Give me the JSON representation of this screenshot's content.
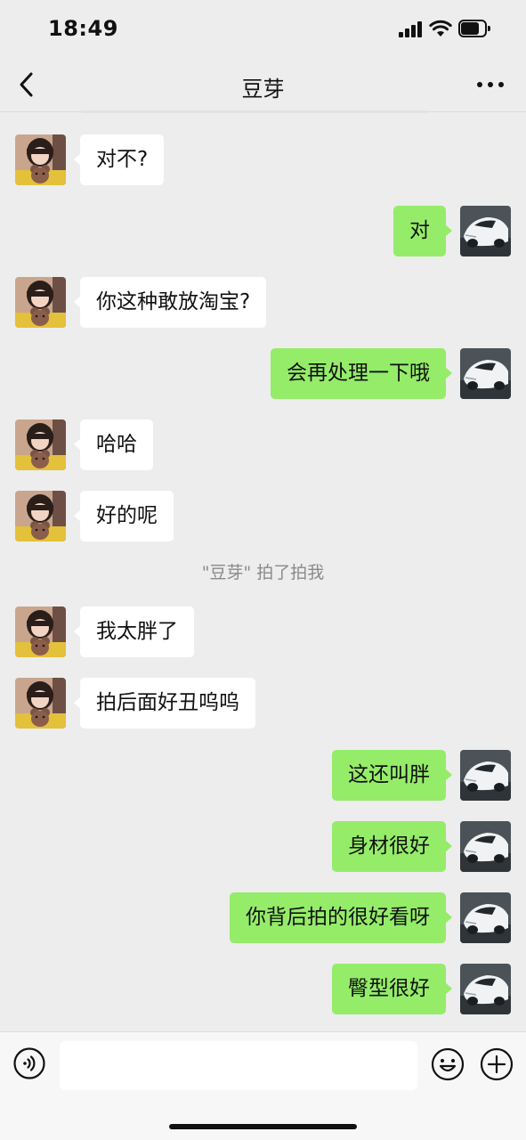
{
  "status_bar": {
    "time": "18:49",
    "battery_level": 0.75
  },
  "header": {
    "title": "豆芽",
    "back_icon": "chevron-left-icon",
    "more_icon": "ellipsis-icon"
  },
  "messages": [
    {
      "side": "received",
      "text": "对不?"
    },
    {
      "side": "sent",
      "text": "对"
    },
    {
      "side": "received",
      "text": "你这种敢放淘宝?"
    },
    {
      "side": "sent",
      "text": "会再处理一下哦"
    },
    {
      "side": "received",
      "text": "哈哈"
    },
    {
      "side": "received",
      "text": "好的呢"
    },
    {
      "side": "system",
      "text": "\"豆芽\" 拍了拍我"
    },
    {
      "side": "received",
      "text": "我太胖了"
    },
    {
      "side": "received",
      "text": "拍后面好丑呜呜"
    },
    {
      "side": "sent",
      "text": "这还叫胖"
    },
    {
      "side": "sent",
      "text": "身材很好"
    },
    {
      "side": "sent",
      "text": "你背后拍的很好看呀"
    },
    {
      "side": "sent",
      "text": "臀型很好"
    }
  ],
  "input_bar": {
    "voice_icon": "voice-icon",
    "text_value": "",
    "emoji_icon": "emoji-icon",
    "plus_icon": "plus-icon"
  },
  "colors": {
    "background": "#ededed",
    "sent_bubble": "#95ec69",
    "received_bubble": "#ffffff",
    "system_text": "#8a8a8a"
  }
}
